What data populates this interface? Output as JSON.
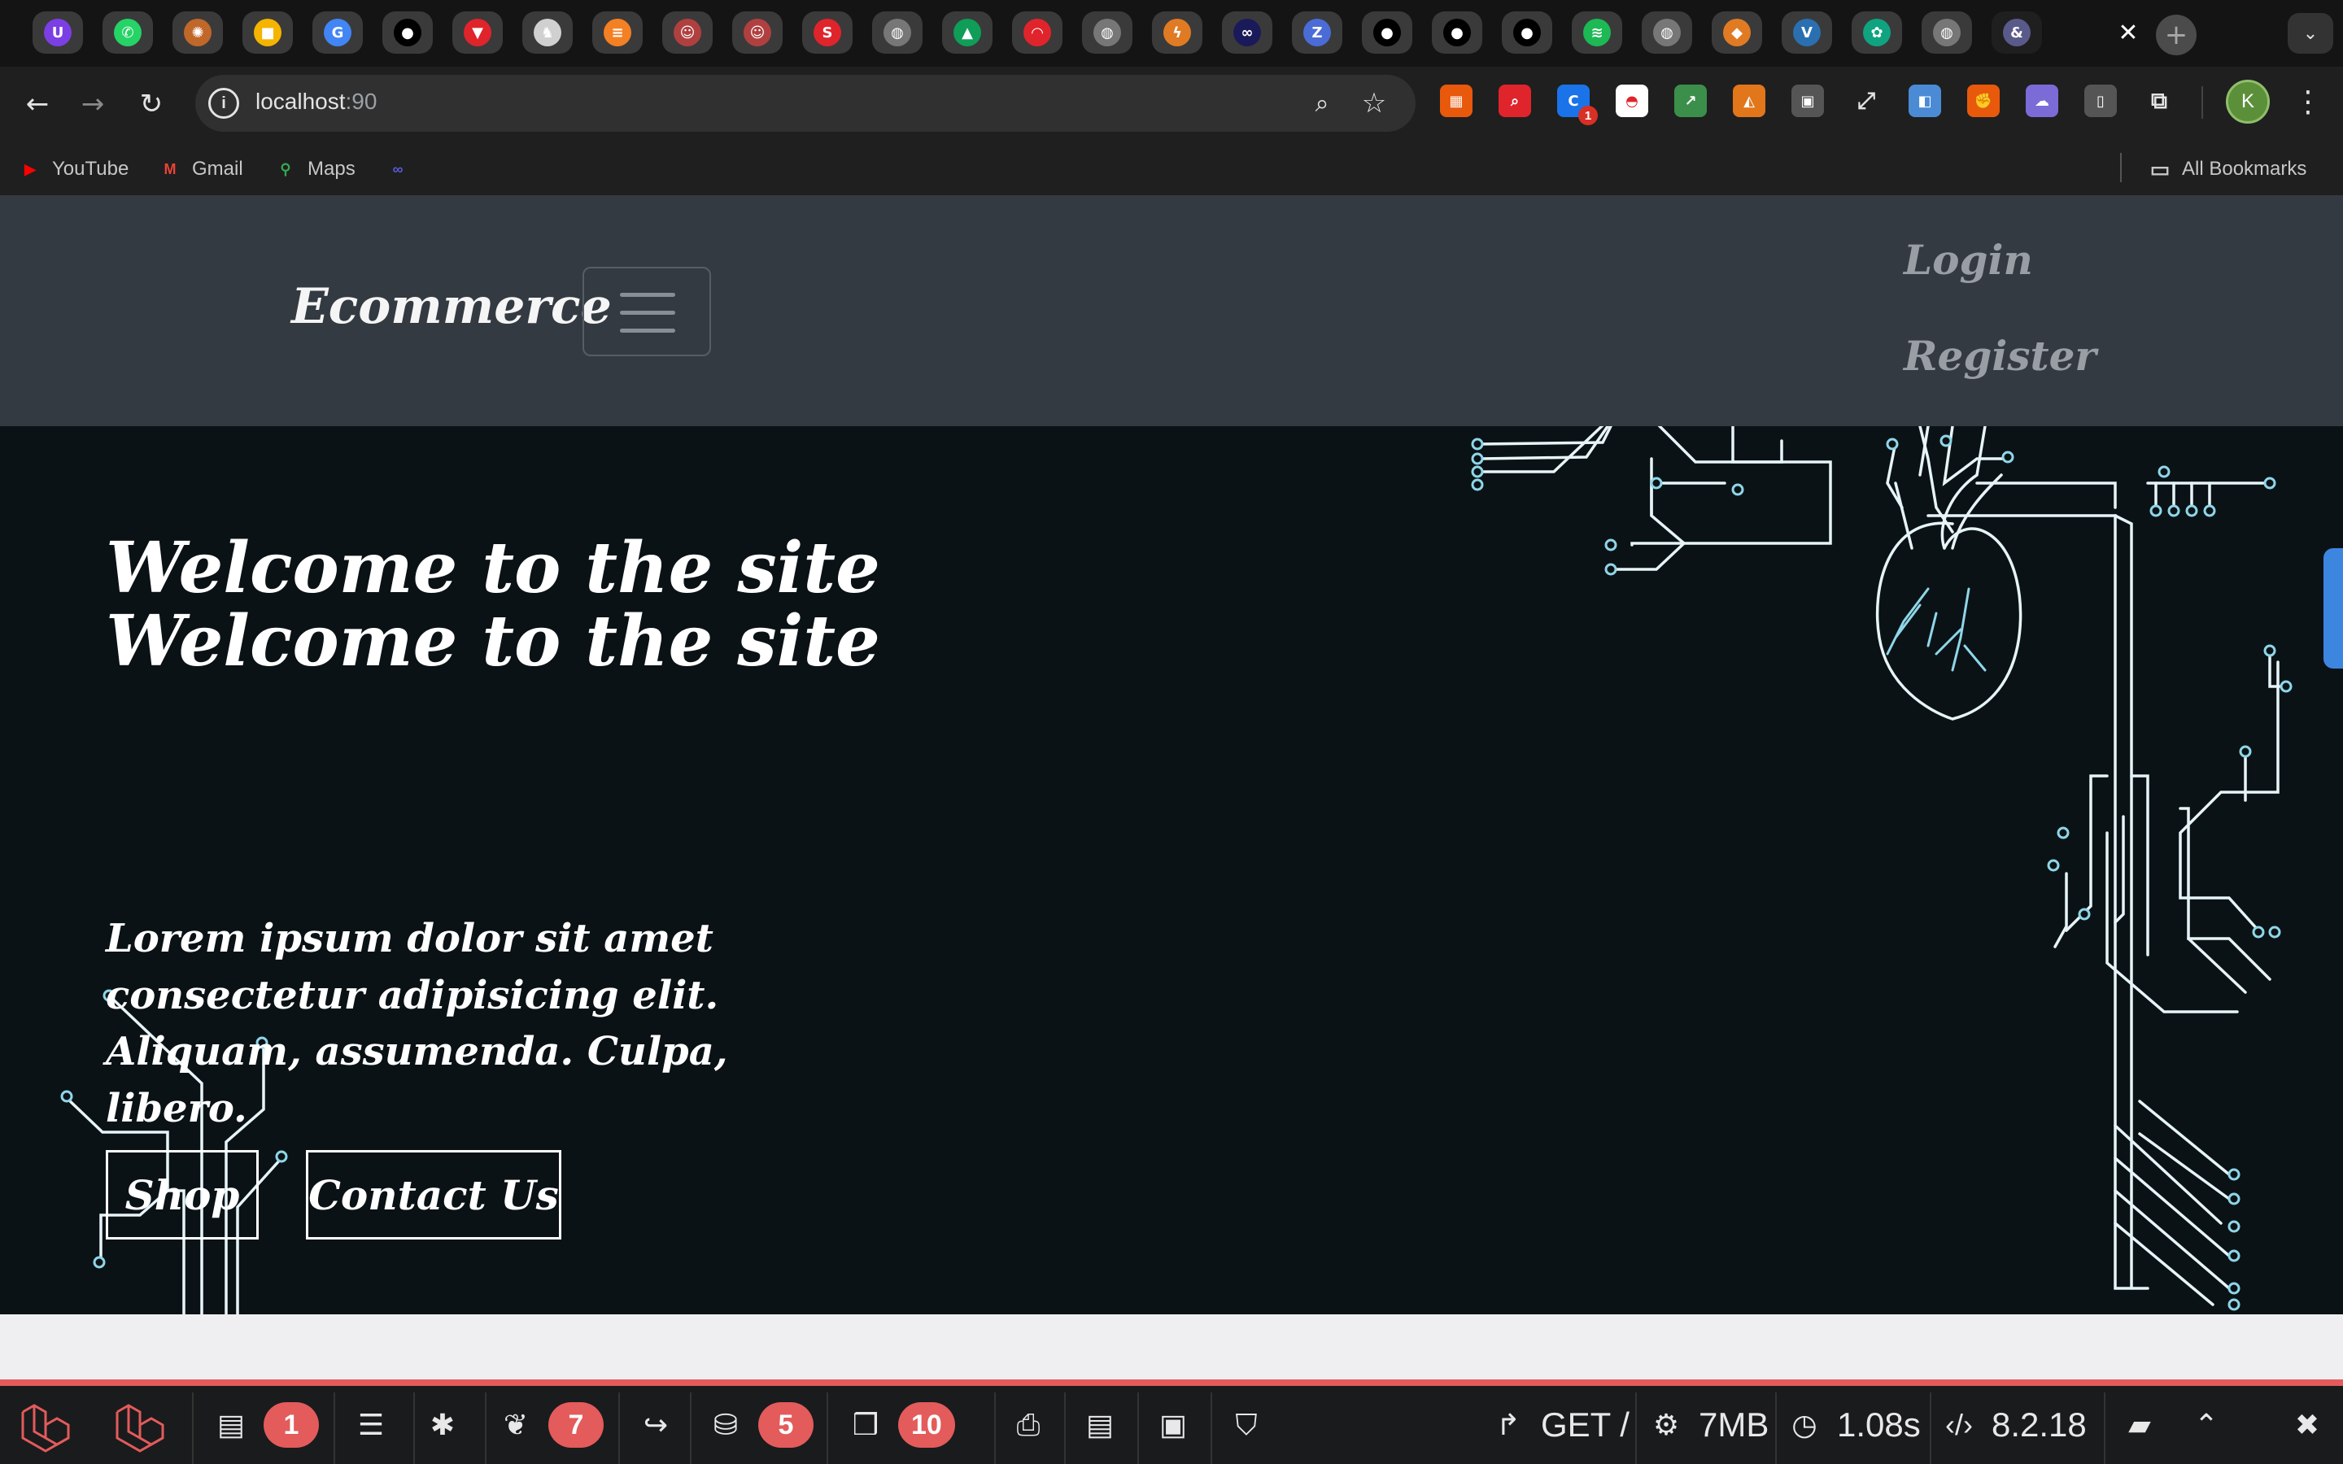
{
  "browser": {
    "tab_close_glyph": "✕",
    "new_tab_glyph": "+",
    "tabs": [
      {
        "icon": "proton-vpn-icon",
        "glyph": "U",
        "color": "#7b3fe4"
      },
      {
        "icon": "whatsapp-icon",
        "glyph": "✆",
        "color": "#25d366"
      },
      {
        "icon": "sunflower-icon",
        "glyph": "✺",
        "color": "#c0672a"
      },
      {
        "icon": "keep-notes-icon",
        "glyph": "■",
        "color": "#f4b400"
      },
      {
        "icon": "gcp-icon",
        "glyph": "G",
        "color": "#4285f4"
      },
      {
        "icon": "github-icon",
        "glyph": "●",
        "color": "#000000"
      },
      {
        "icon": "vivaldi-icon",
        "glyph": "▼",
        "color": "#e0242b"
      },
      {
        "icon": "elephant-icon",
        "glyph": "♞",
        "color": "#d0d0d0"
      },
      {
        "icon": "stackoverflow-icon",
        "glyph": "≡",
        "color": "#f48024"
      },
      {
        "icon": "person-avatar-icon",
        "glyph": "☺",
        "color": "#b04040"
      },
      {
        "icon": "person-avatar-icon",
        "glyph": "☺",
        "color": "#b04040"
      },
      {
        "icon": "s-logo-icon",
        "glyph": "S",
        "color": "#e0242b"
      },
      {
        "icon": "globe-icon",
        "glyph": "◍",
        "color": "#777777"
      },
      {
        "icon": "google-drive-icon",
        "glyph": "▲",
        "color": "#0f9d58"
      },
      {
        "icon": "speedometer-icon",
        "glyph": "◠",
        "color": "#e0242b"
      },
      {
        "icon": "globe-icon",
        "glyph": "◍",
        "color": "#777777"
      },
      {
        "icon": "bolt-icon",
        "glyph": "ϟ",
        "color": "#e07b24"
      },
      {
        "icon": "link-icon",
        "glyph": "∞",
        "color": "#1a1a5a"
      },
      {
        "icon": "z-logo-icon",
        "glyph": "Z",
        "color": "#4b6bd6"
      },
      {
        "icon": "github-icon",
        "glyph": "●",
        "color": "#000000"
      },
      {
        "icon": "github-icon",
        "glyph": "●",
        "color": "#000000"
      },
      {
        "icon": "github-icon",
        "glyph": "●",
        "color": "#000000"
      },
      {
        "icon": "spotify-icon",
        "glyph": "≋",
        "color": "#1db954"
      },
      {
        "icon": "globe-icon",
        "glyph": "◍",
        "color": "#777777"
      },
      {
        "icon": "box-icon",
        "glyph": "◆",
        "color": "#e07b24"
      },
      {
        "icon": "vuetify-icon",
        "glyph": "V",
        "color": "#2a6fb0"
      },
      {
        "icon": "chatgpt-icon",
        "glyph": "✿",
        "color": "#10a37f"
      },
      {
        "icon": "globe-icon",
        "glyph": "◍",
        "color": "#777777"
      },
      {
        "icon": "ampersand-icon",
        "glyph": "&",
        "color": "#5a5a8a"
      }
    ],
    "address": {
      "host": "localhost",
      "port": ":90"
    },
    "extensions": [
      {
        "icon": "ext-orange-icon",
        "glyph": "▦",
        "color": "#e8590c"
      },
      {
        "icon": "ext-search-icon",
        "glyph": "⌕",
        "color": "#e0242b"
      },
      {
        "icon": "ext-c-icon",
        "glyph": "C",
        "color": "#1a73e8",
        "badge": "1"
      },
      {
        "icon": "pokeball-icon",
        "glyph": "◓",
        "color": "#ffffff"
      },
      {
        "icon": "ext-chart-icon",
        "glyph": "↗",
        "color": "#3c8f4a"
      },
      {
        "icon": "metamask-icon",
        "glyph": "◭",
        "color": "#e2761b"
      },
      {
        "icon": "ext-vault-icon",
        "glyph": "▣",
        "color": "#555555"
      },
      {
        "icon": "fullscreen-icon",
        "glyph": "⤢",
        "color": "#1f1f1f"
      },
      {
        "icon": "ext-blue-icon",
        "glyph": "◧",
        "color": "#4b8bd6"
      },
      {
        "icon": "ext-fist-icon",
        "glyph": "✊",
        "color": "#e8590c"
      },
      {
        "icon": "ext-ghost-icon",
        "glyph": "☁",
        "color": "#7b6bd6"
      },
      {
        "icon": "mouse-icon",
        "glyph": "▯",
        "color": "#555555"
      },
      {
        "icon": "puzzle-icon",
        "glyph": "⧉",
        "color": "#1f1f1f"
      }
    ],
    "profile_initial": "K",
    "menu_glyph": "⋮",
    "bookmarks": [
      {
        "label": "YouTube",
        "icon": "youtube-icon",
        "glyph": "▶",
        "color": "#ff0000"
      },
      {
        "label": "Gmail",
        "icon": "gmail-icon",
        "glyph": "M",
        "color": "#ea4335"
      },
      {
        "label": "Maps",
        "icon": "maps-icon",
        "glyph": "⚲",
        "color": "#34a853"
      },
      {
        "label": "",
        "icon": "link-icon",
        "glyph": "∞",
        "color": "#5a5ad6"
      }
    ],
    "all_bookmarks": "All Bookmarks"
  },
  "page": {
    "brand": "Ecommerce",
    "nav": {
      "login": "Login",
      "register": "Register"
    },
    "hero": {
      "title_line1": "Welcome to the site",
      "title_line2": "Welcome to the site",
      "text": "Lorem ipsum dolor sit amet consectetur adipisicing elit. Aliquam, assumenda. Culpa, libero.",
      "shop_button": "Shop",
      "contact_button": "Contact Us"
    },
    "circuit_color": "#8fd6e8"
  },
  "debugbar": {
    "accent": "#e35b5b",
    "messages_count": "1",
    "views_count": "7",
    "queries_count": "5",
    "models_count": "10",
    "method": "GET /",
    "memory": "7MB",
    "time": "1.08s",
    "php_version": "8.2.18"
  }
}
